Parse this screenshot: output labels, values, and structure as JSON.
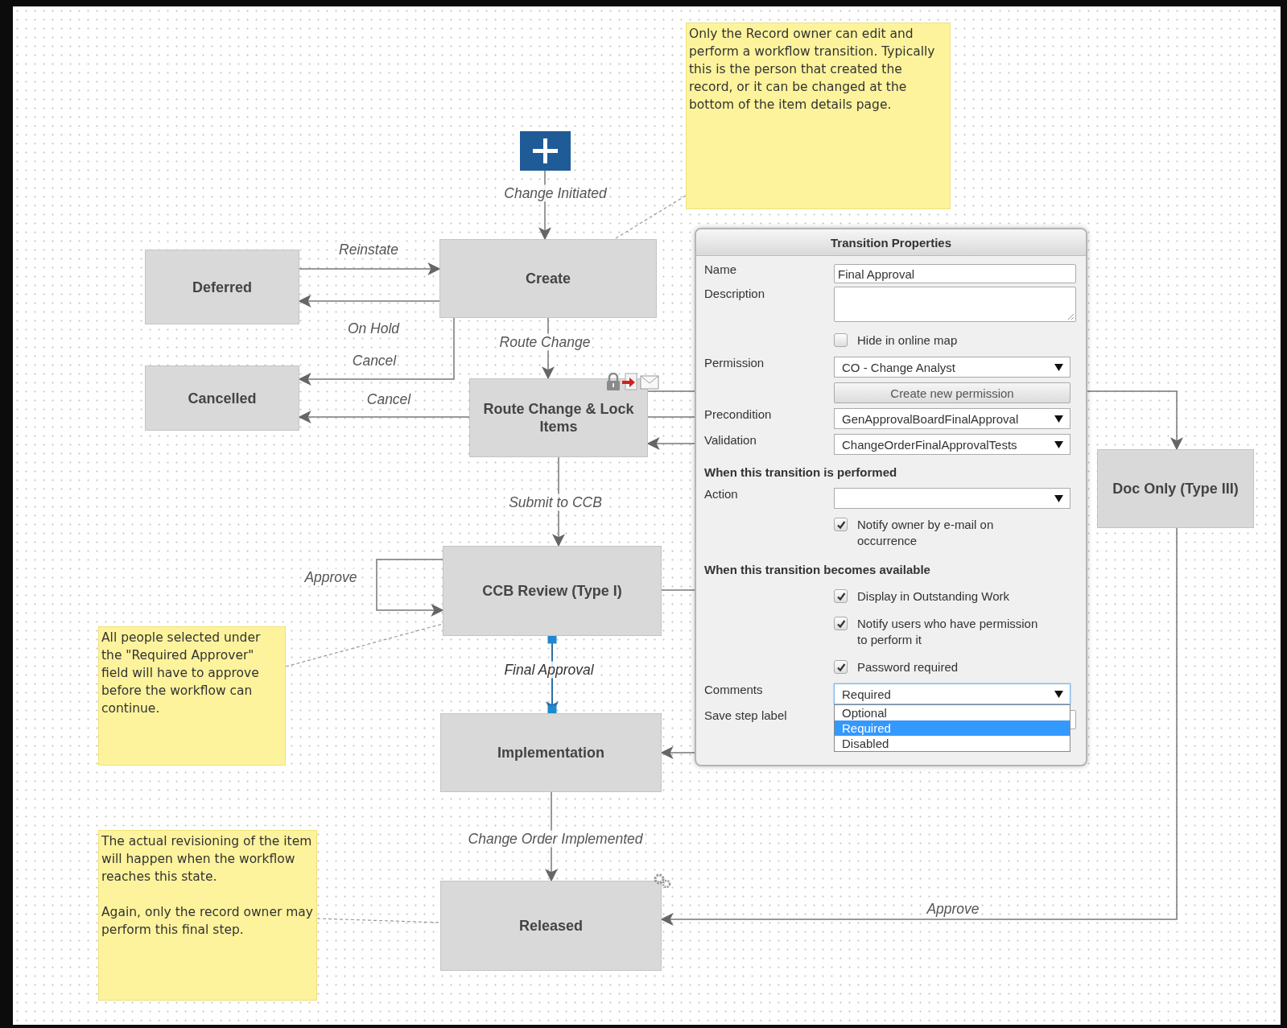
{
  "states": [
    {
      "label": "Deferred"
    },
    {
      "label": "Create"
    },
    {
      "label": "Cancelled"
    },
    {
      "label": "Route Change & Lock Items"
    },
    {
      "label": "CCB Review (Type I)"
    },
    {
      "label": "Implementation"
    },
    {
      "label": "Released"
    },
    {
      "label": "Doc Only (Type III)"
    }
  ],
  "transitions": [
    {
      "label": "Change Initiated",
      "selected": false
    },
    {
      "label": "Reinstate",
      "selected": false
    },
    {
      "label": "On Hold",
      "selected": false
    },
    {
      "label": "Cancel",
      "selected": false
    },
    {
      "label": "Route Change",
      "selected": false
    },
    {
      "label": "Cancel",
      "selected": false
    },
    {
      "label": "Submit to CCB",
      "selected": false
    },
    {
      "label": "Approve",
      "selected": false
    },
    {
      "label": "Final Approval",
      "selected": true
    },
    {
      "label": "Change Order Implemented",
      "selected": false
    },
    {
      "label": "Approve",
      "selected": false
    }
  ],
  "notes": [
    {
      "paragraphs": [
        "Only the Record owner can edit and perform a workflow transition. Typically this is the person that created the record, or it can be changed at the bottom of the item details page."
      ]
    },
    {
      "paragraphs": [
        "All people selected under the \"Required Approver\" field will have to approve before the workflow can continue."
      ]
    },
    {
      "paragraphs": [
        "The actual revisioning of the item will happen when the workflow reaches this state.",
        "Again, only the record owner may perform this final step."
      ]
    }
  ],
  "dialog": {
    "title": "Transition Properties",
    "rows": [
      {
        "kind": "text",
        "label": "Name",
        "value": "Final Approval"
      },
      {
        "kind": "textarea",
        "label": "Description"
      },
      {
        "kind": "checkbox",
        "text": "Hide in online map",
        "checked": false
      },
      {
        "kind": "select",
        "label": "Permission",
        "value": "CO - Change Analyst",
        "expanded": false
      },
      {
        "kind": "button",
        "text": "Create new permission"
      },
      {
        "kind": "select",
        "label": "Precondition",
        "value": "GenApprovalBoardFinalApproval",
        "expanded": false
      },
      {
        "kind": "select",
        "label": "Validation",
        "value": "ChangeOrderFinalApprovalTests",
        "expanded": false
      },
      {
        "kind": "heading",
        "text": "When this transition is performed"
      },
      {
        "kind": "select",
        "label": "Action",
        "expanded": false
      },
      {
        "kind": "checkbox",
        "text": "Notify owner by e-mail on occurrence",
        "checked": true
      },
      {
        "kind": "heading",
        "text": "When this transition becomes available"
      },
      {
        "kind": "checkbox",
        "text": "Display in Outstanding Work",
        "checked": true
      },
      {
        "kind": "checkbox",
        "text": "Notify users who have permission to perform it",
        "checked": true
      },
      {
        "kind": "checkbox",
        "text": "Password required",
        "checked": true
      },
      {
        "kind": "select",
        "label": "Comments",
        "value": "Required",
        "expanded": true,
        "options": [
          {
            "label": "Optional",
            "selected": false
          },
          {
            "label": "Required",
            "selected": true
          },
          {
            "label": "Disabled",
            "selected": false
          }
        ]
      },
      {
        "kind": "text",
        "label": "Save step label"
      }
    ]
  }
}
